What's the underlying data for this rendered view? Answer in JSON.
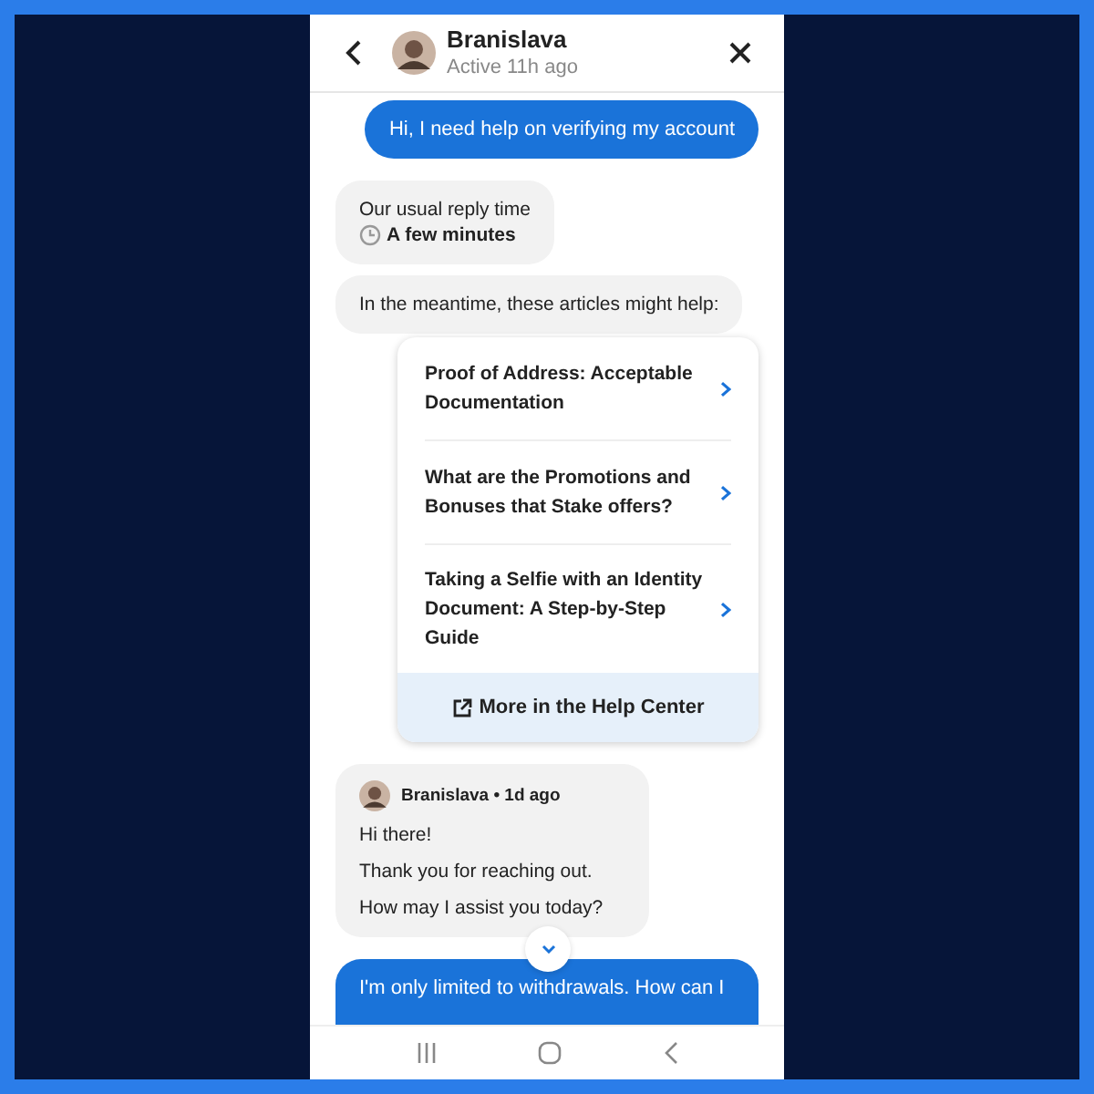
{
  "header": {
    "name": "Branislava",
    "status": "Active 11h ago"
  },
  "messages": [
    {
      "kind": "user",
      "text": "Hi, I need help on verifying my account"
    },
    {
      "kind": "reply_time",
      "label": "Our usual reply time",
      "value": "A few minutes"
    },
    {
      "kind": "bot",
      "text": "In the meantime, these articles might help:"
    },
    {
      "kind": "articles",
      "items": [
        "Proof of Address: Acceptable Documentation",
        "What are the Promotions and Bonuses that Stake offers?",
        "Taking a Selfie with an Identity Document: A Step-by-Step Guide"
      ],
      "footer": "More in the Help Center"
    },
    {
      "kind": "agent",
      "author": "Branislava • 1d ago",
      "lines": [
        "Hi there!",
        "Thank you for reaching out.",
        "How may I assist you today?"
      ]
    },
    {
      "kind": "user",
      "text": "I'm only limited to withdrawals. How can I"
    }
  ]
}
